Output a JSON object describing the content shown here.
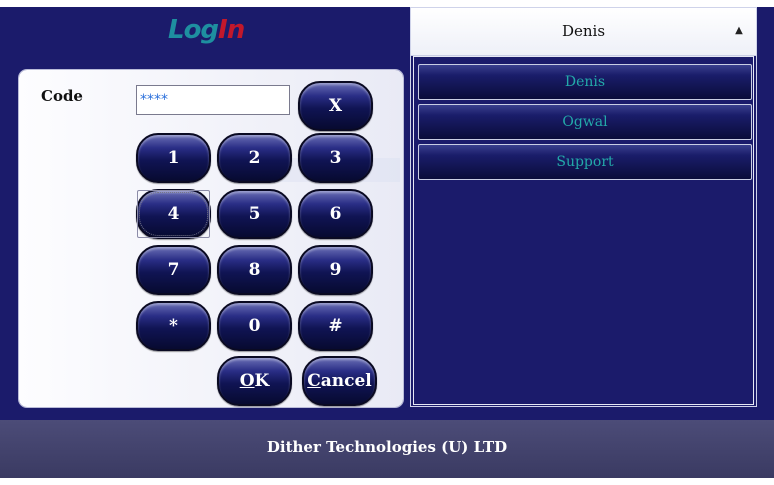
{
  "logo": {
    "part1": "Log",
    "part2": "In"
  },
  "code": {
    "label": "Code",
    "value": "****"
  },
  "keypad": {
    "clear": "X",
    "digits": [
      "1",
      "2",
      "3",
      "4",
      "5",
      "6",
      "7",
      "8",
      "9"
    ],
    "star": "*",
    "zero": "0",
    "hash": "#",
    "ok": "OK",
    "cancel": "Cancel"
  },
  "users": {
    "selected": "Denis",
    "items": [
      "Denis",
      "Ogwal",
      "Support"
    ]
  },
  "footer": {
    "company": "Dither Technologies (U) LTD"
  },
  "colors": {
    "background": "#1b1b6b",
    "user_text": "#23a9a9",
    "logo_log": "#1e8fa0",
    "logo_in": "#c2182b"
  }
}
